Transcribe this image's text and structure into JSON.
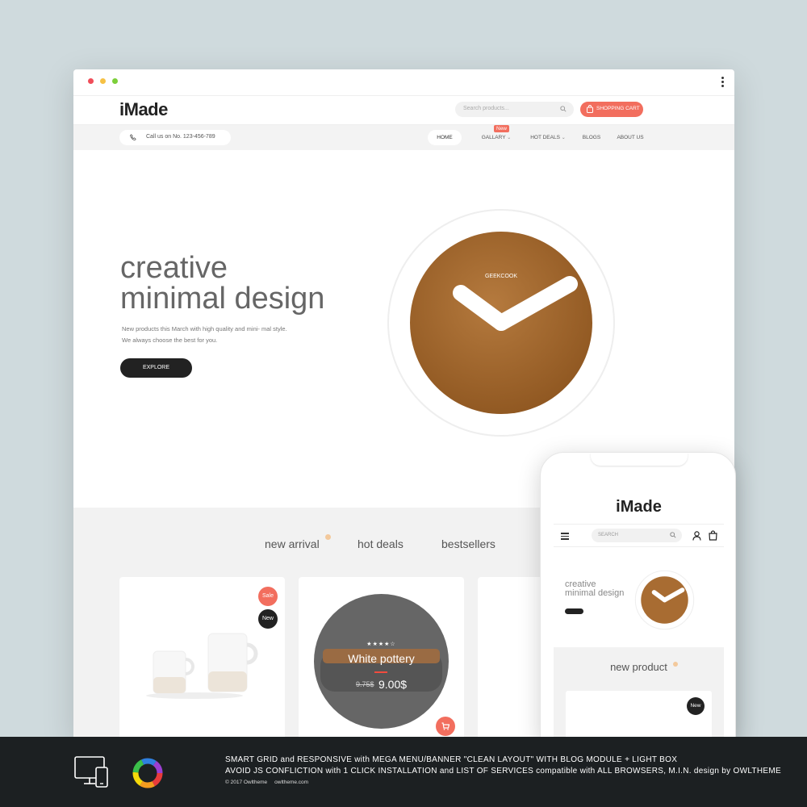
{
  "brand": "iMade",
  "header": {
    "search_placeholder": "Search products...",
    "cart_label": "SHOPPING CART",
    "call_text": "Call us on No. 123-456-789"
  },
  "nav": {
    "home": "HOME",
    "gallery": "GALLARY",
    "new_badge": "New",
    "hot_deals": "HOT DEALS",
    "blogs": "BLOGS",
    "about": "ABOUT US"
  },
  "hero": {
    "title_line1": "creative",
    "title_line2": "minimal design",
    "text": "New products this March with high quality and mini- mal style. We always choose the best for you.",
    "cta": "EXPLORE",
    "clock_brand": "GEEKCOOK"
  },
  "product_tabs": [
    "new arrival",
    "hot deals",
    "bestsellers"
  ],
  "products": {
    "card1": {
      "sale_badge": "Sale",
      "new_badge": "New"
    },
    "card2": {
      "name": "White pottery",
      "old_price": "9.75$",
      "price": "9.00$",
      "rating_stars": "★★★★☆"
    }
  },
  "mobile": {
    "brand": "iMade",
    "search_placeholder": "SEARCH",
    "hero_line1": "creative",
    "hero_line2": "minimal design",
    "section_title": "new product",
    "new_badge": "New"
  },
  "footer": {
    "line1": "SMART GRID and RESPONSIVE with MEGA MENU/BANNER \"CLEAN LAYOUT\" WITH BLOG MODULE + LIGHT BOX",
    "line2": "AVOID JS CONFLICTION with 1 CLICK INSTALLATION and LIST OF SERVICES compatible with ALL BROWSERS, M.I.N. design by OWLTHEME",
    "copyright": "© 2017 Owltheme",
    "website": "owltheme.com"
  },
  "colors": {
    "accent": "#f26e5e",
    "dark": "#222222",
    "window_dots": [
      "#f04d59",
      "#f6c144",
      "#7ccf3a"
    ],
    "background": "#cfdadd"
  }
}
